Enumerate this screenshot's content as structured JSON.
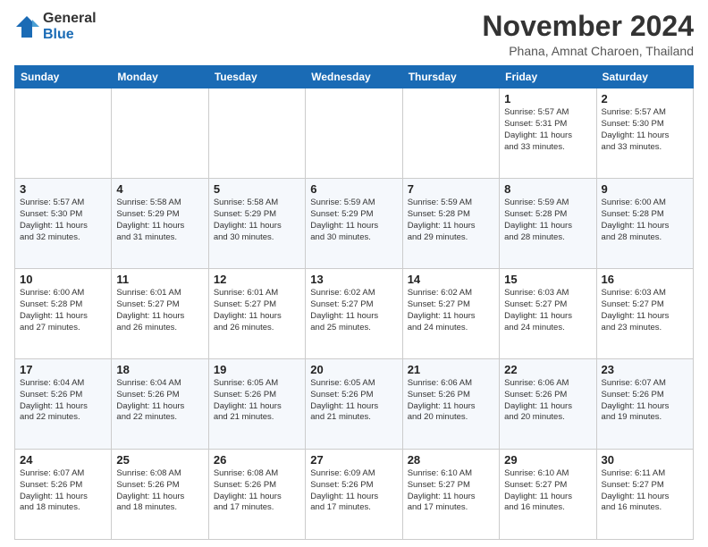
{
  "header": {
    "logo": {
      "general": "General",
      "blue": "Blue"
    },
    "title": "November 2024",
    "location": "Phana, Amnat Charoen, Thailand"
  },
  "calendar": {
    "headers": [
      "Sunday",
      "Monday",
      "Tuesday",
      "Wednesday",
      "Thursday",
      "Friday",
      "Saturday"
    ],
    "weeks": [
      [
        {
          "day": "",
          "info": ""
        },
        {
          "day": "",
          "info": ""
        },
        {
          "day": "",
          "info": ""
        },
        {
          "day": "",
          "info": ""
        },
        {
          "day": "",
          "info": ""
        },
        {
          "day": "1",
          "info": "Sunrise: 5:57 AM\nSunset: 5:31 PM\nDaylight: 11 hours\nand 33 minutes."
        },
        {
          "day": "2",
          "info": "Sunrise: 5:57 AM\nSunset: 5:30 PM\nDaylight: 11 hours\nand 33 minutes."
        }
      ],
      [
        {
          "day": "3",
          "info": "Sunrise: 5:57 AM\nSunset: 5:30 PM\nDaylight: 11 hours\nand 32 minutes."
        },
        {
          "day": "4",
          "info": "Sunrise: 5:58 AM\nSunset: 5:29 PM\nDaylight: 11 hours\nand 31 minutes."
        },
        {
          "day": "5",
          "info": "Sunrise: 5:58 AM\nSunset: 5:29 PM\nDaylight: 11 hours\nand 30 minutes."
        },
        {
          "day": "6",
          "info": "Sunrise: 5:59 AM\nSunset: 5:29 PM\nDaylight: 11 hours\nand 30 minutes."
        },
        {
          "day": "7",
          "info": "Sunrise: 5:59 AM\nSunset: 5:28 PM\nDaylight: 11 hours\nand 29 minutes."
        },
        {
          "day": "8",
          "info": "Sunrise: 5:59 AM\nSunset: 5:28 PM\nDaylight: 11 hours\nand 28 minutes."
        },
        {
          "day": "9",
          "info": "Sunrise: 6:00 AM\nSunset: 5:28 PM\nDaylight: 11 hours\nand 28 minutes."
        }
      ],
      [
        {
          "day": "10",
          "info": "Sunrise: 6:00 AM\nSunset: 5:28 PM\nDaylight: 11 hours\nand 27 minutes."
        },
        {
          "day": "11",
          "info": "Sunrise: 6:01 AM\nSunset: 5:27 PM\nDaylight: 11 hours\nand 26 minutes."
        },
        {
          "day": "12",
          "info": "Sunrise: 6:01 AM\nSunset: 5:27 PM\nDaylight: 11 hours\nand 26 minutes."
        },
        {
          "day": "13",
          "info": "Sunrise: 6:02 AM\nSunset: 5:27 PM\nDaylight: 11 hours\nand 25 minutes."
        },
        {
          "day": "14",
          "info": "Sunrise: 6:02 AM\nSunset: 5:27 PM\nDaylight: 11 hours\nand 24 minutes."
        },
        {
          "day": "15",
          "info": "Sunrise: 6:03 AM\nSunset: 5:27 PM\nDaylight: 11 hours\nand 24 minutes."
        },
        {
          "day": "16",
          "info": "Sunrise: 6:03 AM\nSunset: 5:27 PM\nDaylight: 11 hours\nand 23 minutes."
        }
      ],
      [
        {
          "day": "17",
          "info": "Sunrise: 6:04 AM\nSunset: 5:26 PM\nDaylight: 11 hours\nand 22 minutes."
        },
        {
          "day": "18",
          "info": "Sunrise: 6:04 AM\nSunset: 5:26 PM\nDaylight: 11 hours\nand 22 minutes."
        },
        {
          "day": "19",
          "info": "Sunrise: 6:05 AM\nSunset: 5:26 PM\nDaylight: 11 hours\nand 21 minutes."
        },
        {
          "day": "20",
          "info": "Sunrise: 6:05 AM\nSunset: 5:26 PM\nDaylight: 11 hours\nand 21 minutes."
        },
        {
          "day": "21",
          "info": "Sunrise: 6:06 AM\nSunset: 5:26 PM\nDaylight: 11 hours\nand 20 minutes."
        },
        {
          "day": "22",
          "info": "Sunrise: 6:06 AM\nSunset: 5:26 PM\nDaylight: 11 hours\nand 20 minutes."
        },
        {
          "day": "23",
          "info": "Sunrise: 6:07 AM\nSunset: 5:26 PM\nDaylight: 11 hours\nand 19 minutes."
        }
      ],
      [
        {
          "day": "24",
          "info": "Sunrise: 6:07 AM\nSunset: 5:26 PM\nDaylight: 11 hours\nand 18 minutes."
        },
        {
          "day": "25",
          "info": "Sunrise: 6:08 AM\nSunset: 5:26 PM\nDaylight: 11 hours\nand 18 minutes."
        },
        {
          "day": "26",
          "info": "Sunrise: 6:08 AM\nSunset: 5:26 PM\nDaylight: 11 hours\nand 17 minutes."
        },
        {
          "day": "27",
          "info": "Sunrise: 6:09 AM\nSunset: 5:26 PM\nDaylight: 11 hours\nand 17 minutes."
        },
        {
          "day": "28",
          "info": "Sunrise: 6:10 AM\nSunset: 5:27 PM\nDaylight: 11 hours\nand 17 minutes."
        },
        {
          "day": "29",
          "info": "Sunrise: 6:10 AM\nSunset: 5:27 PM\nDaylight: 11 hours\nand 16 minutes."
        },
        {
          "day": "30",
          "info": "Sunrise: 6:11 AM\nSunset: 5:27 PM\nDaylight: 11 hours\nand 16 minutes."
        }
      ]
    ]
  }
}
